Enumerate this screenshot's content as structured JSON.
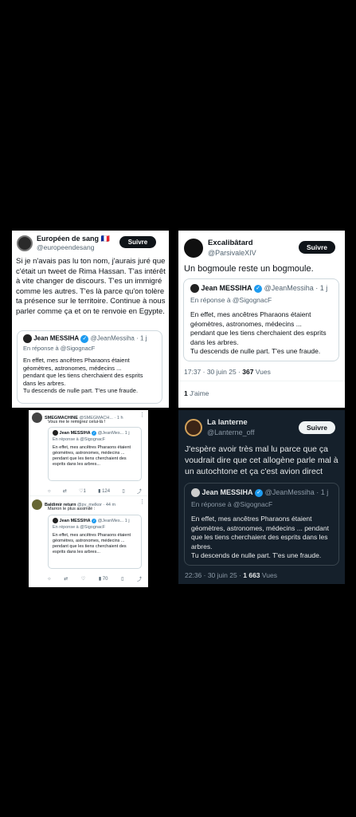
{
  "colors": {
    "background": "#000000",
    "accent": "#1d9bf0",
    "dark_panel": "#15202b"
  },
  "quote": {
    "name": "Jean MESSIHA",
    "handle": "@JeanMessiha",
    "time": "1 j",
    "reply_to": "En réponse à @SigognacF",
    "text": "En effet, mes ancêtres Pharaons étaient géomètres, astronomes, médecins ... pendant que les tiens cherchaient des esprits dans les arbres.\nTu descends de nulle part. T'es une fraude."
  },
  "panel1": {
    "name": "Européen de sang",
    "flag": "🇫🇷",
    "handle": "@europeendesang",
    "follow": "Suivre",
    "text": "Si je n'avais pas lu ton nom, j'aurais juré que c'était un tweet de Rima Hassan. T'as intérêt à vite changer de discours. T'es un immigré comme les autres. T'es là parce qu'on tolère ta présence sur le territoire. Continue à nous parler comme ça et on te renvoie en Egypte.",
    "quote_text": "En effet, mes ancêtres Pharaons étaient géomètres, astronomes, médecins ...\npendant que les tiens cherchaient des esprits dans les arbres.\nTu descends de nulle part. T'es une fraude."
  },
  "panel2": {
    "name": "Excalibâtard",
    "handle": "@ParsivaleXIV",
    "follow": "Suivre",
    "text": "Un bogmoule reste un bogmoule.",
    "quote_text": "En effet, mes ancêtres Pharaons étaient géomètres, astronomes, médecins ...\npendant que les tiens cherchaient des esprits dans les arbres.\nTu descends de nulle part. T'es une fraude.",
    "timestamp": "17:37 · 30 juin 25 · ",
    "views_count": "367",
    "views_label": " Vues",
    "likes_count": "1",
    "likes_label": " J'aime"
  },
  "panel3": {
    "reply1": {
      "name": "SMEGMACHINE",
      "handle": "@SMEGMACH...",
      "time": "· 1 h",
      "text": "Vous me le remigrez celui-là !",
      "quote_text": "En effet, mes ancêtres Pharaons étaient géomètres, astronomes, médecins ... pendant que les tiens cherchaient des esprits dans les arbres...",
      "views": "124"
    },
    "reply2": {
      "name": "Baldimir return",
      "handle": "@pv_melkor",
      "time": "· 44 m",
      "text": "Marron le plus assimilé :",
      "quote_text": "En effet, mes ancêtres Pharaons étaient géomètres, astronomes, médecins ... pendant que les tiens cherchaient des esprits dans les arbres...",
      "views": "70"
    },
    "quote_handle": "@JeanMes..."
  },
  "panel4": {
    "name": "La lanterne",
    "handle": "@Lanterne_off",
    "follow": "Suivre",
    "text": "J'espère avoir très mal lu parce que ça voudrait dire que cet allogène parle mal à un autochtone et ça c'est avion direct",
    "quote_text": "En effet, mes ancêtres Pharaons étaient géomètres, astronomes, médecins ... pendant que les tiens cherchaient des esprits dans les arbres.\nTu descends de nulle part. T'es une fraude.",
    "timestamp": "22:36 · 30 juin 25 · ",
    "views_count": "1 663",
    "views_label": " Vues"
  }
}
